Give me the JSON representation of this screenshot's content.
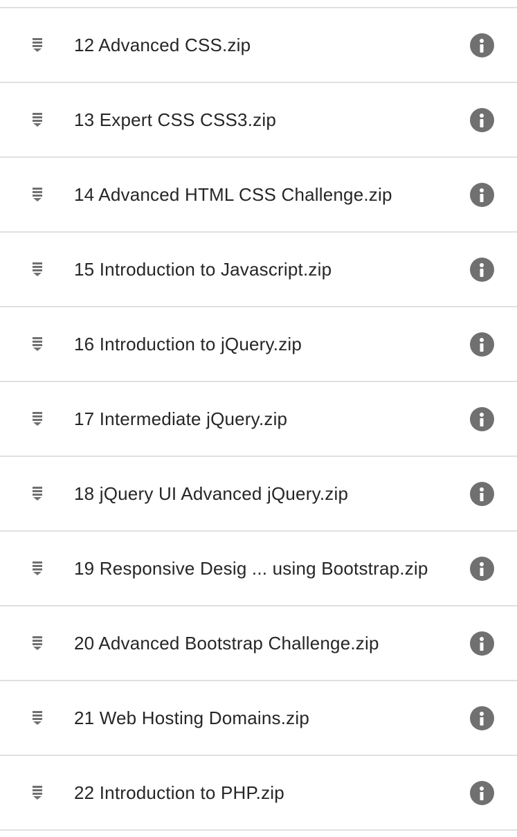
{
  "files": [
    {
      "name": "12 Advanced CSS.zip",
      "icon": "archive-icon",
      "action_icon": "info-icon"
    },
    {
      "name": "13 Expert CSS CSS3.zip",
      "icon": "archive-icon",
      "action_icon": "info-icon"
    },
    {
      "name": "14 Advanced HTML CSS Challenge.zip",
      "icon": "archive-icon",
      "action_icon": "info-icon"
    },
    {
      "name": "15 Introduction to Javascript.zip",
      "icon": "archive-icon",
      "action_icon": "info-icon"
    },
    {
      "name": "16 Introduction to jQuery.zip",
      "icon": "archive-icon",
      "action_icon": "info-icon"
    },
    {
      "name": "17 Intermediate jQuery.zip",
      "icon": "archive-icon",
      "action_icon": "info-icon"
    },
    {
      "name": "18 jQuery UI Advanced jQuery.zip",
      "icon": "archive-icon",
      "action_icon": "info-icon"
    },
    {
      "name": "19 Responsive Desig ... using Bootstrap.zip",
      "icon": "archive-icon",
      "action_icon": "info-icon"
    },
    {
      "name": "20 Advanced Bootstrap Challenge.zip",
      "icon": "archive-icon",
      "action_icon": "info-icon"
    },
    {
      "name": "21 Web Hosting Domains.zip",
      "icon": "archive-icon",
      "action_icon": "info-icon"
    },
    {
      "name": "22 Introduction to PHP.zip",
      "icon": "archive-icon",
      "action_icon": "info-icon"
    }
  ],
  "colors": {
    "divider": "#e0e0e0",
    "icon": "#707070",
    "text": "#262626",
    "background": "#ffffff"
  }
}
